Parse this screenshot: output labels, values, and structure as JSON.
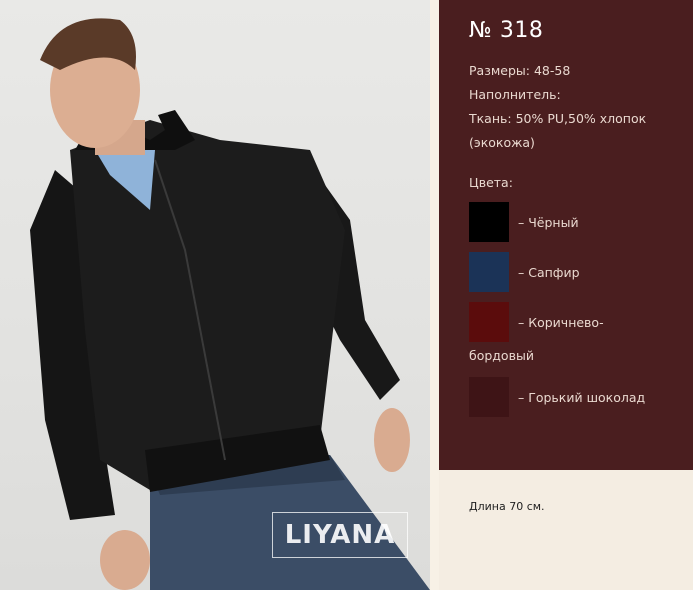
{
  "product": {
    "number": "№ 318",
    "sizes": "Размеры: 48-58",
    "filler": "Наполнитель:",
    "fabric_line1": "Ткань: 50% PU,50% хлопок",
    "fabric_line2": "(экокожа)",
    "colors_heading": "Цвета:",
    "colors": [
      {
        "label": "– Чёрный",
        "hex": "#000000"
      },
      {
        "label": "– Сапфир",
        "hex": "#1b3357"
      },
      {
        "label_line1": "– Коричнево-",
        "label_line2": "бордовый",
        "hex": "#5b0c0c"
      },
      {
        "label": "– Горький шоколад",
        "hex": "#3e1416"
      }
    ],
    "length": "Длина 70 см."
  },
  "brand": {
    "logo_text": "LIYANA"
  },
  "palette": {
    "panel": "#4a1e1f",
    "background": "#f4ede2"
  }
}
